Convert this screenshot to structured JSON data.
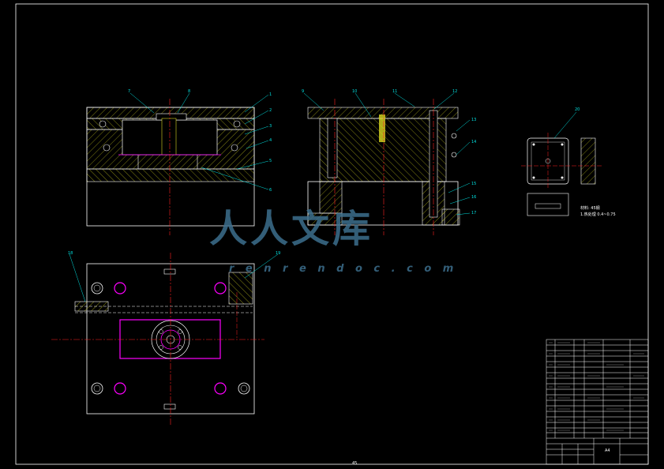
{
  "watermark": {
    "text": "人人文库",
    "url": "r e n r e n d o c . c o m"
  },
  "sheet": {
    "page_number": "45",
    "title_block_label": "A4"
  },
  "side_view": {
    "legend_line_1": "材料: 45钢",
    "legend_line_2": "1.热处理 0.4~0.75"
  },
  "balloons": [
    "1",
    "2",
    "3",
    "4",
    "5",
    "6",
    "7",
    "8",
    "9",
    "10",
    "11",
    "12",
    "13",
    "14",
    "15",
    "16",
    "17",
    "18",
    "19",
    "20"
  ],
  "colors": {
    "outline": "#ffffff",
    "centerline": "#ff2020",
    "hatch": "#d8d820",
    "leader": "#00e0e0",
    "highlight": "#ff00ff",
    "watermark": "#3c6f8e"
  }
}
